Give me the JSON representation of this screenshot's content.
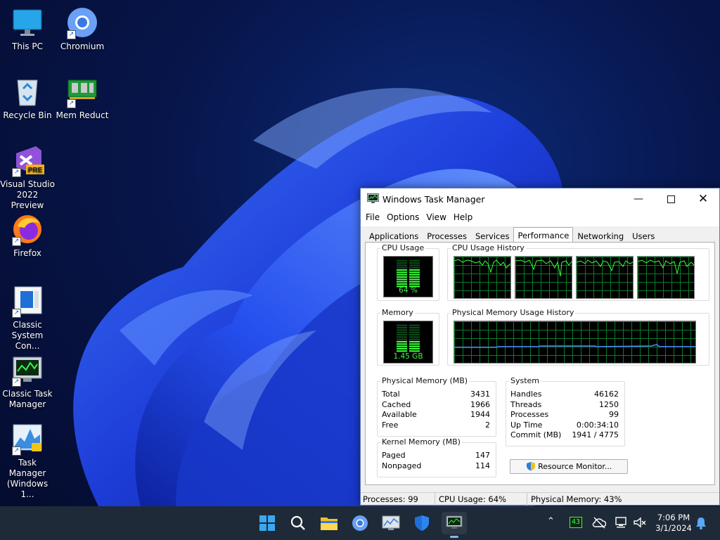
{
  "desktop": {
    "icons": [
      {
        "label": "This PC",
        "icon": "monitor-icon"
      },
      {
        "label": "Chromium",
        "icon": "chromium-icon"
      },
      {
        "label": "Recycle Bin",
        "icon": "recycle-bin-icon"
      },
      {
        "label": "Mem Reduct",
        "icon": "memory-chip-icon"
      },
      {
        "label": "Visual Studio 2022 Preview",
        "icon": "visual-studio-icon",
        "badge": "PRE"
      },
      {
        "label": "Firefox",
        "icon": "firefox-icon"
      },
      {
        "label": "Classic System Con...",
        "icon": "control-panel-icon"
      },
      {
        "label": "Classic Task Manager",
        "icon": "task-manager-icon"
      },
      {
        "label": "Task Manager (Windows 1...",
        "icon": "task-manager-modern-icon"
      }
    ]
  },
  "window": {
    "title": "Windows Task Manager",
    "menu": [
      "File",
      "Options",
      "View",
      "Help"
    ],
    "tabs": [
      "Applications",
      "Processes",
      "Services",
      "Performance",
      "Networking",
      "Users"
    ],
    "active_tab": "Performance",
    "cpu_usage": {
      "label": "CPU Usage",
      "value_text": "64 %",
      "percent": 64
    },
    "cpu_history": {
      "label": "CPU Usage History",
      "cores": 4
    },
    "memory": {
      "label": "Memory",
      "value_text": "1.45 GB",
      "percent": 43
    },
    "memory_history": {
      "label": "Physical Memory Usage History"
    },
    "physical_memory": {
      "label": "Physical Memory (MB)",
      "rows": [
        {
          "k": "Total",
          "v": "3431"
        },
        {
          "k": "Cached",
          "v": "1966"
        },
        {
          "k": "Available",
          "v": "1944"
        },
        {
          "k": "Free",
          "v": "2"
        }
      ]
    },
    "kernel_memory": {
      "label": "Kernel Memory (MB)",
      "rows": [
        {
          "k": "Paged",
          "v": "147"
        },
        {
          "k": "Nonpaged",
          "v": "114"
        }
      ]
    },
    "system": {
      "label": "System",
      "rows": [
        {
          "k": "Handles",
          "v": "46162"
        },
        {
          "k": "Threads",
          "v": "1250"
        },
        {
          "k": "Processes",
          "v": "99"
        },
        {
          "k": "Up Time",
          "v": "0:00:34:10"
        },
        {
          "k": "Commit (MB)",
          "v": "1941 / 4775"
        }
      ]
    },
    "resource_monitor_button": "Resource Monitor...",
    "status": {
      "processes": "Processes: 99",
      "cpu": "CPU Usage: 64%",
      "memory": "Physical Memory: 43%"
    }
  },
  "taskbar": {
    "apps": [
      "start-icon",
      "search-icon",
      "file-explorer-icon",
      "chromium-icon",
      "resource-monitor-icon",
      "security-shield-icon",
      "task-manager-icon"
    ],
    "tray": {
      "cpu_badge": "43"
    },
    "clock": {
      "time": "7:06 PM",
      "date": "3/1/2024"
    }
  },
  "colors": {
    "accent": "#0067c0",
    "graph_green": "#3aff3a",
    "graph_grid": "#0a7c2a",
    "taskbar": "#1f2a38"
  }
}
